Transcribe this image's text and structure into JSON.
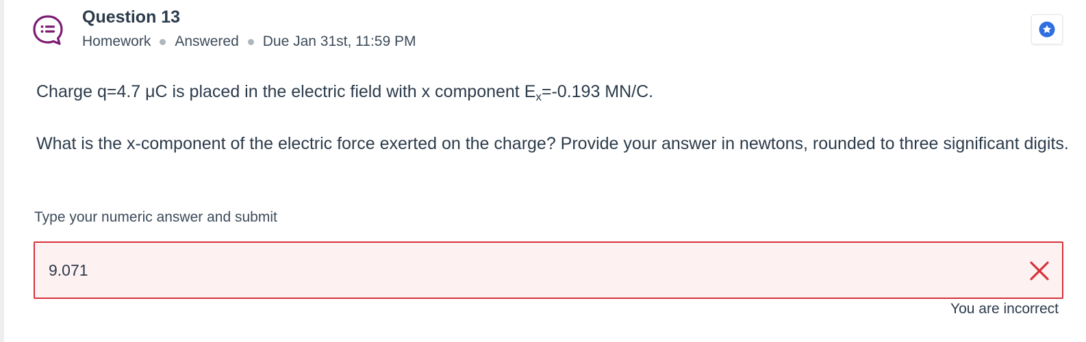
{
  "header": {
    "question_icon": "question-chat-icon",
    "title": "Question 13",
    "meta": {
      "type": "Homework",
      "status": "Answered",
      "due": "Due Jan 31st, 11:59 PM"
    },
    "bookmark_icon": "star-badge-icon"
  },
  "question": {
    "line1_before_sub": "Charge q=4.7 μC is placed in the electric field with x component E",
    "line1_sub": "x",
    "line1_after_sub": "=-0.193 MN/C.",
    "line2": "What is the x-component of the electric force exerted on the charge? Provide your answer in newtons, rounded to three significant digits."
  },
  "answer": {
    "label": "Type your numeric answer and submit",
    "value": "9.071",
    "result_icon": "incorrect-x-icon",
    "feedback": "You are incorrect"
  },
  "colors": {
    "icon_purple": "#7b1a72",
    "error_red": "#d6313a",
    "error_bg": "#fdf1f2",
    "star_blue": "#2f6fe0"
  }
}
